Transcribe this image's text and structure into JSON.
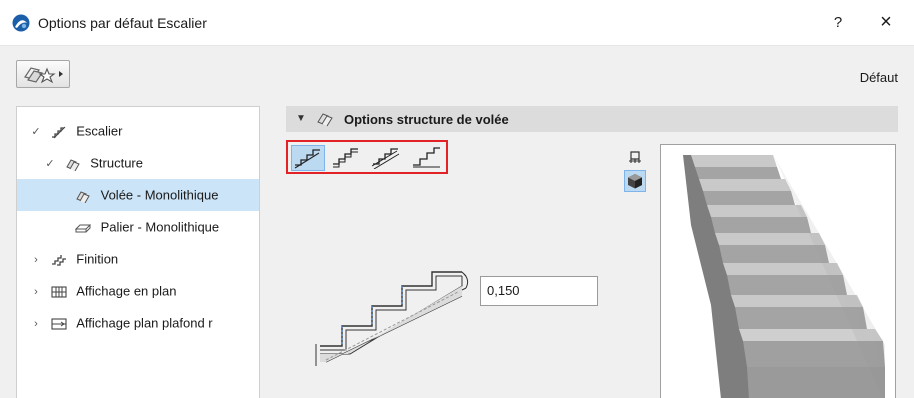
{
  "window": {
    "title": "Options par défaut Escalier",
    "help_label": "?",
    "close_label": "×"
  },
  "toolbar": {
    "default_label": "Défaut"
  },
  "tree": {
    "items": [
      {
        "label": "Escalier",
        "expanded": true
      },
      {
        "label": "Structure",
        "expanded": true
      },
      {
        "label": "Volée - Monolithique",
        "selected": true
      },
      {
        "label": "Palier - Monolithique"
      },
      {
        "label": "Finition",
        "expanded": false
      },
      {
        "label": "Affichage en plan",
        "expanded": false
      },
      {
        "label": "Affichage plan plafond r",
        "expanded": false
      }
    ]
  },
  "panel": {
    "title": "Options structure de volée",
    "riser_value": "0,150"
  },
  "colors": {
    "selection": "#cce4f7",
    "highlight_border": "#e32226",
    "active_button": "#bcd9f2"
  }
}
